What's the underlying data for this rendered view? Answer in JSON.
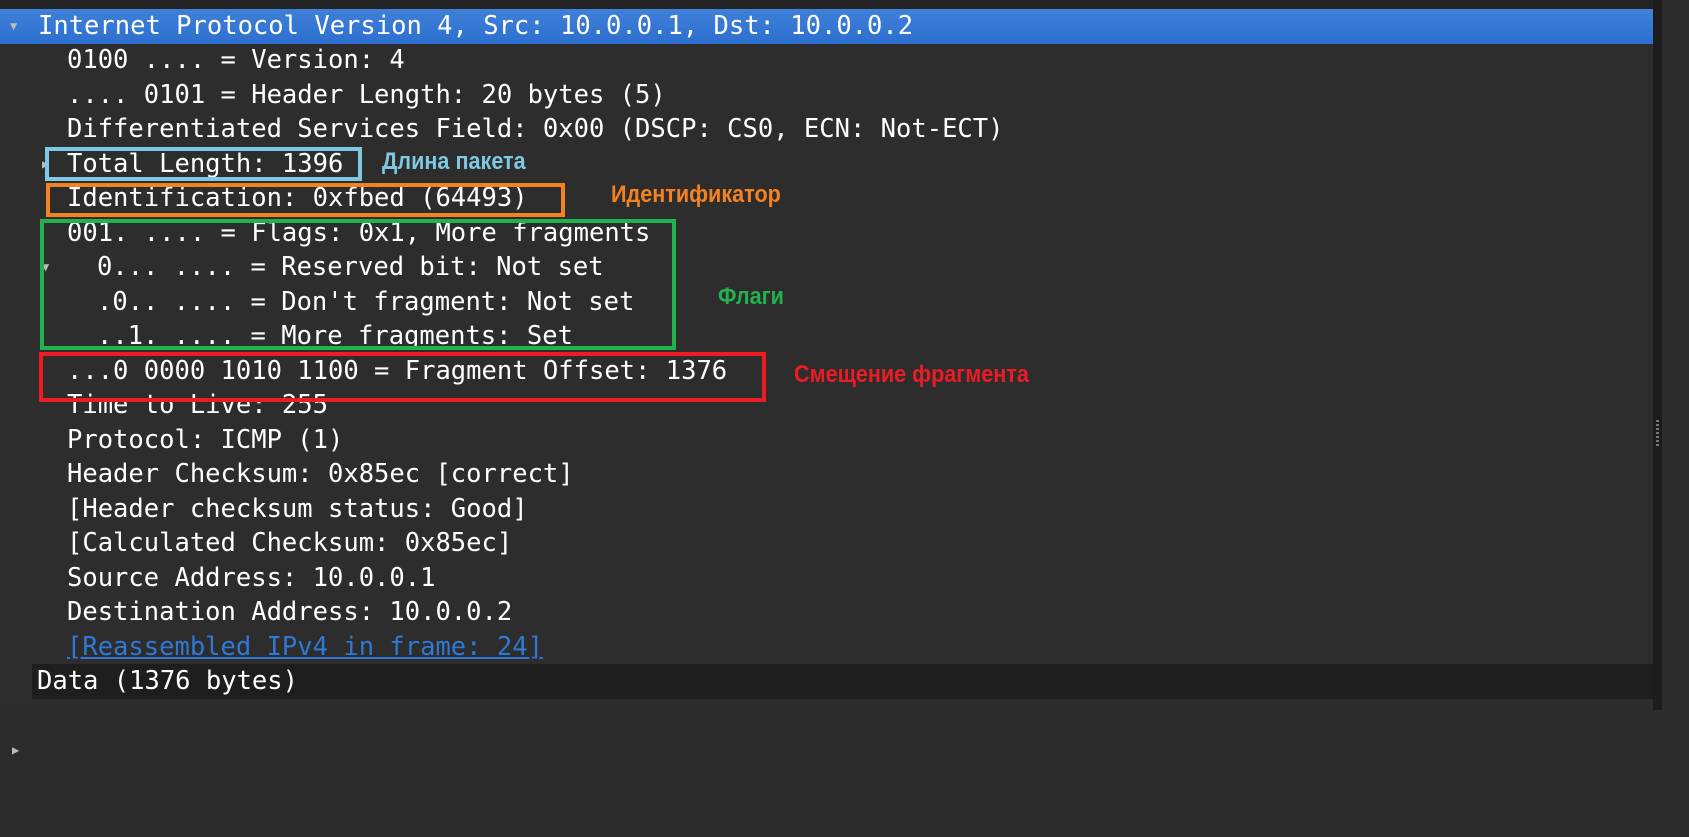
{
  "tree": {
    "selected": "Internet Protocol Version 4, Src: 10.0.0.1, Dst: 10.0.0.2",
    "fields": [
      "0100 .... = Version: 4",
      ".... 0101 = Header Length: 20 bytes (5)",
      "Differentiated Services Field: 0x00 (DSCP: CS0, ECN: Not-ECT)",
      "Total Length: 1396",
      "Identification: 0xfbed (64493)",
      "001. .... = Flags: 0x1, More fragments",
      "0... .... = Reserved bit: Not set",
      ".0.. .... = Don't fragment: Not set",
      "..1. .... = More fragments: Set",
      "...0 0000 1010 1100 = Fragment Offset: 1376",
      "Time to Live: 255",
      "Protocol: ICMP (1)",
      "Header Checksum: 0x85ec [correct]",
      "[Header checksum status: Good]",
      "[Calculated Checksum: 0x85ec]",
      "Source Address: 10.0.0.1",
      "Destination Address: 10.0.0.2",
      "[Reassembled IPv4 in frame: 24]"
    ],
    "data_row": "Data (1376 bytes)"
  },
  "annotations": {
    "total_length": {
      "label": "Длина пакета",
      "color": "#7ec8e3"
    },
    "identification": {
      "label": "Идентификатор",
      "color": "#f58220"
    },
    "flags": {
      "label": "Флаги",
      "color": "#22b14c"
    },
    "fragment_offset": {
      "label": "Смещение фрагмента",
      "color": "#ed1c24"
    }
  },
  "colors": {
    "selection": "#2f72d0",
    "link": "#2f78d4",
    "background": "#2d2d2d"
  }
}
